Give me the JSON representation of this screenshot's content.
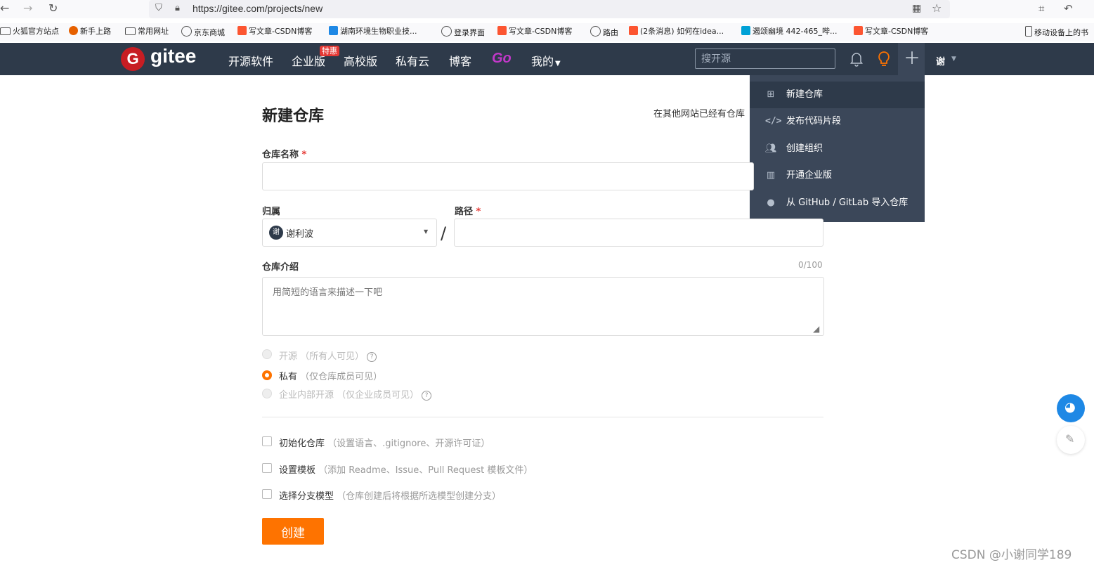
{
  "browser": {
    "url": "https://gitee.com/projects/new",
    "bookmarks": [
      {
        "label": "火狐官方站点",
        "icon": "folder-icon",
        "color": "#555555"
      },
      {
        "label": "新手上路",
        "icon": "firefox-icon",
        "color": "#e66000"
      },
      {
        "label": "常用网址",
        "icon": "folder-icon",
        "color": "#555555"
      },
      {
        "label": "京东商城",
        "icon": "globe-icon",
        "color": "#555555"
      },
      {
        "label": "写文章-CSDN博客",
        "icon": "csdn-icon",
        "color": "#fc5531"
      },
      {
        "label": "湖南环境生物职业技...",
        "icon": "school-icon",
        "color": "#1e88e5"
      },
      {
        "label": "登录界面",
        "icon": "globe-icon",
        "color": "#555555"
      },
      {
        "label": "写文章-CSDN博客",
        "icon": "csdn-icon",
        "color": "#fc5531"
      },
      {
        "label": "路由",
        "icon": "globe-icon",
        "color": "#555555"
      },
      {
        "label": "(2条消息) 如何在idea...",
        "icon": "csdn-icon",
        "color": "#fc5531"
      },
      {
        "label": "遏颂幽境 442-465_哔...",
        "icon": "bilibili-icon",
        "color": "#00a1d6"
      },
      {
        "label": "写文章-CSDN博客",
        "icon": "csdn-icon",
        "color": "#fc5531"
      }
    ],
    "mobile_bookmarks": "移动设备上的书"
  },
  "header": {
    "logo_letter": "G",
    "logo_text": "gitee",
    "nav": [
      "开源软件",
      "企业版",
      "高校版",
      "私有云",
      "博客"
    ],
    "badge": "特惠",
    "go_label": "Go",
    "mine_label": "我的",
    "search_placeholder": "搜开源",
    "avatar_char": "谢",
    "colors": {
      "nav_bg": "#2e3a4a",
      "brand_red": "#c71d23",
      "accent_orange": "#fe7300"
    }
  },
  "dropdown": {
    "items": [
      {
        "label": "新建仓库",
        "icon": "plus-square-icon"
      },
      {
        "label": "发布代码片段",
        "icon": "code-icon"
      },
      {
        "label": "创建组织",
        "icon": "users-icon"
      },
      {
        "label": "开通企业版",
        "icon": "building-icon"
      },
      {
        "label": "从 GitHub / GitLab 导入仓库",
        "icon": "github-icon"
      }
    ]
  },
  "form": {
    "title": "新建仓库",
    "import_hint": "在其他网站已经有仓库",
    "name_label": "仓库名称",
    "required_mark": "*",
    "owner_label": "归属",
    "owner_value": "谢利波",
    "owner_avatar": "谢",
    "slash": "/",
    "path_label": "路径",
    "intro_label": "仓库介绍",
    "intro_count": "0/100",
    "intro_placeholder": "用简短的语言来描述一下吧",
    "visibility": [
      {
        "label": "开源",
        "hint": "（所有人可见）",
        "selected": false,
        "disabled": true,
        "help": "?"
      },
      {
        "label": "私有",
        "hint": "（仅仓库成员可见）",
        "selected": true,
        "disabled": false,
        "help": ""
      },
      {
        "label": "企业内部开源",
        "hint": "（仅企业成员可见）",
        "selected": false,
        "disabled": true,
        "help": "?"
      }
    ],
    "options": [
      {
        "label": "初始化仓库",
        "hint": "（设置语言、.gitignore、开源许可证）",
        "checked": false
      },
      {
        "label": "设置模板",
        "hint": "（添加 Readme、Issue、Pull Request 模板文件）",
        "checked": false
      },
      {
        "label": "选择分支模型",
        "hint": "（仓库创建后将根据所选模型创建分支）",
        "checked": false
      }
    ],
    "submit_label": "创建"
  },
  "watermark": "CSDN @小谢同学189"
}
